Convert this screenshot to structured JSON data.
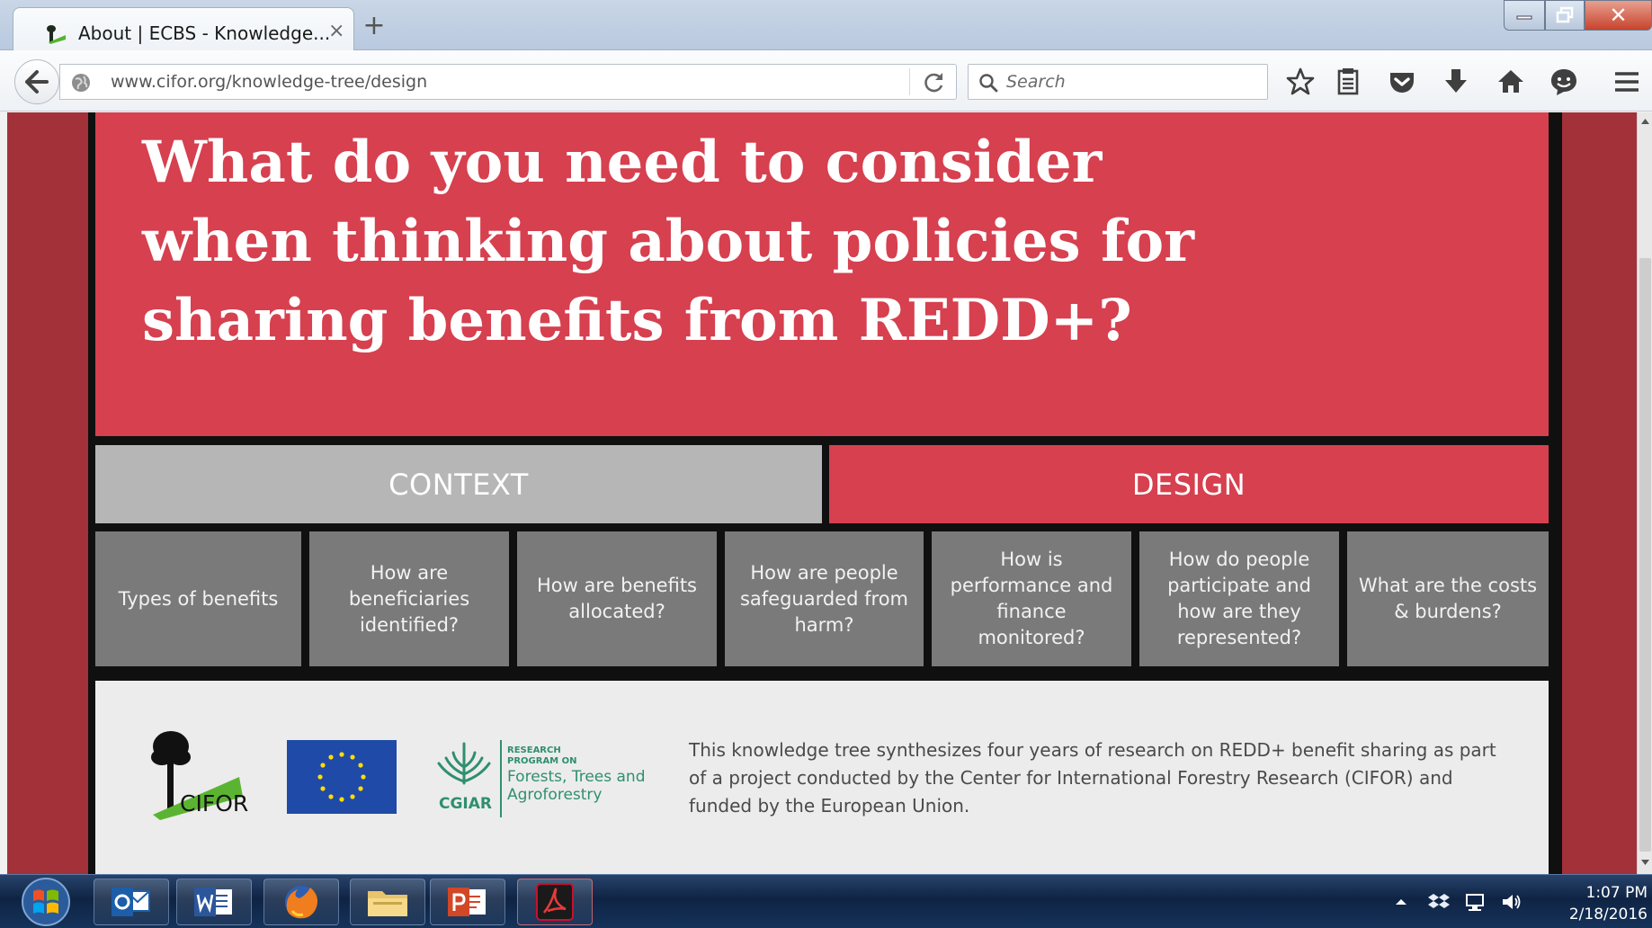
{
  "browser": {
    "tab_title": "About | ECBS - Knowledge...",
    "url": "www.cifor.org/knowledge-tree/design",
    "search_placeholder": "Search"
  },
  "page": {
    "hero_title": "What do you need to consider when thinking about policies for sharing benefits from REDD+?",
    "tabs": [
      {
        "label": "CONTEXT",
        "active": false
      },
      {
        "label": "DESIGN",
        "active": true
      }
    ],
    "topics": [
      "Types of benefits",
      "How are beneficiaries identified?",
      "How are benefits allocated?",
      "How are people safeguarded from harm?",
      "How is performance and finance monitored?",
      "How do people participate and how are they represented?",
      "What are the costs & burdens?"
    ],
    "footer": {
      "logos": {
        "cifor": "CIFOR",
        "cgiar": "CGIAR",
        "crp_small": "RESEARCH PROGRAM ON",
        "crp_name": "Forests, Trees and Agroforestry"
      },
      "text": "This knowledge tree synthesizes four years of research on REDD+ benefit sharing as part of a project conducted by the Center for International Forestry Research (CIFOR) and funded by the European Union."
    }
  },
  "taskbar": {
    "time": "1:07 PM",
    "date": "2/18/2016"
  },
  "colors": {
    "accent_red": "#d6404f",
    "page_bg": "#a3313a",
    "context_gray": "#b6b6b6",
    "topic_gray": "#7a7a7a"
  },
  "icons": [
    "back-arrow-icon",
    "globe-icon",
    "reload-icon",
    "search-icon",
    "bookmark-star-icon",
    "reading-list-icon",
    "pocket-icon",
    "download-icon",
    "home-icon",
    "hello-chat-icon",
    "menu-icon",
    "windows-start-icon",
    "outlook-icon",
    "word-icon",
    "firefox-icon",
    "file-explorer-icon",
    "powerpoint-icon",
    "acrobat-icon",
    "dropbox-icon",
    "network-icon",
    "volume-icon"
  ]
}
